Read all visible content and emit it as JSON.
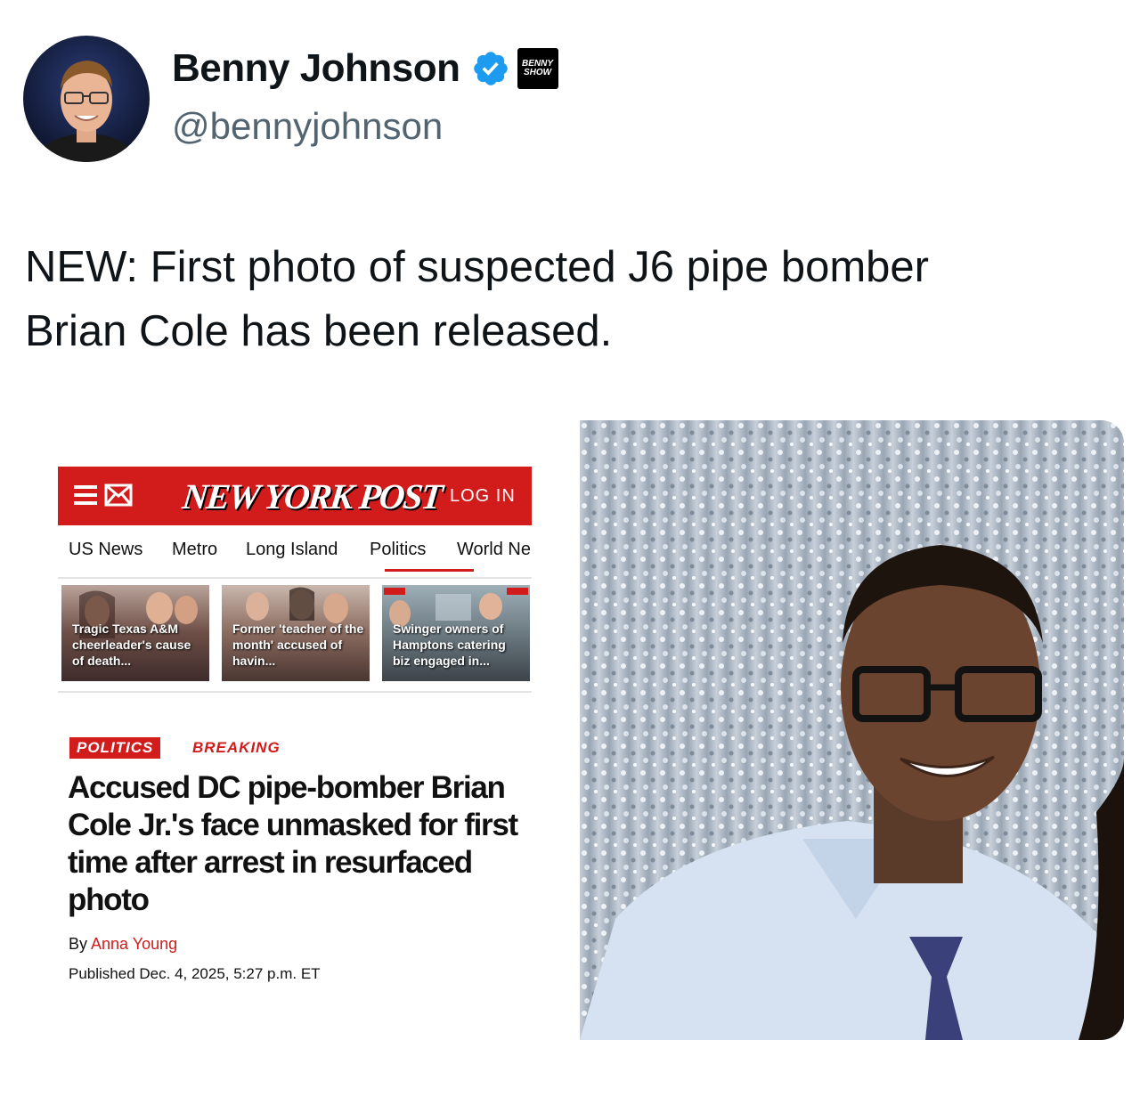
{
  "tweet": {
    "author": {
      "display_name": "Benny Johnson",
      "handle": "@bennyjohnson",
      "affiliate_badge_line1": "BENNY",
      "affiliate_badge_line2": "SHOW"
    },
    "text_line1": "NEW: First photo of suspected J6 pipe bomber",
    "text_line2": "Brian Cole has been released."
  },
  "article_screenshot": {
    "logo": "NEW YORK POST",
    "login_label": "LOG IN",
    "nav": [
      "US News",
      "Metro",
      "Long Island",
      "Politics",
      "World Ne"
    ],
    "thumbnails": [
      {
        "caption": "Tragic Texas A&M cheerleader's cause of death..."
      },
      {
        "caption": "Former 'teacher of the month' accused of havin..."
      },
      {
        "caption": "Swinger owners of Hamptons catering biz engaged in..."
      }
    ],
    "section_tag": "POLITICS",
    "breaking_label": "BREAKING",
    "headline": "Accused DC pipe-bomber Brian Cole Jr.'s face unmasked for first time after arrest in resurfaced photo",
    "byline_prefix": "By",
    "author": "Anna Young",
    "published": "Published Dec. 4, 2025, 5:27 p.m. ET"
  },
  "colors": {
    "brand_red": "#d21b1b",
    "verified_blue": "#1d9bf0",
    "handle_gray": "#536471"
  }
}
